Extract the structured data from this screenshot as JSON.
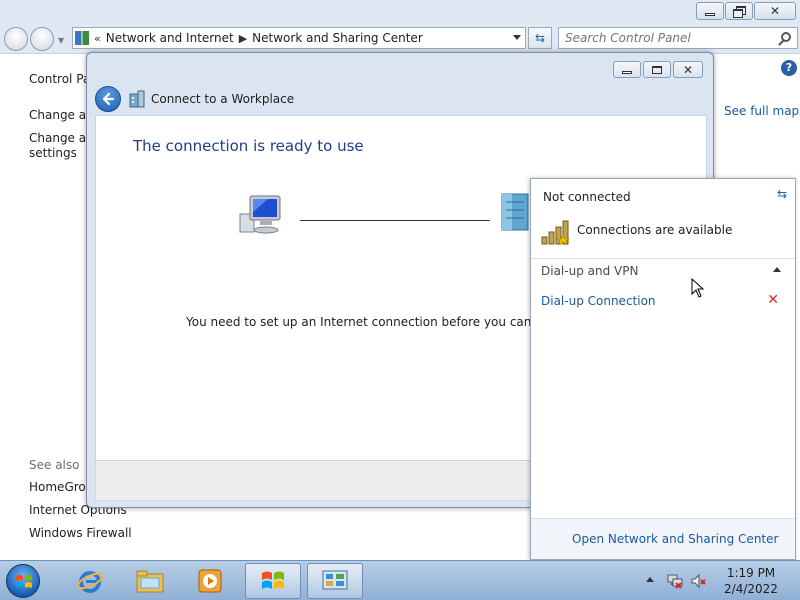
{
  "control_panel": {
    "breadcrumb_chevrons": "«",
    "breadcrumb": [
      "Network and Internet",
      "Network and Sharing Center"
    ],
    "search_placeholder": "Search Control Panel",
    "sidebar_links": [
      "Control Pa",
      "Change ad",
      "Change ad",
      "settings"
    ],
    "see_also_label": "See also",
    "see_also_links": [
      "HomeGrou",
      "Internet Options",
      "Windows Firewall"
    ],
    "see_full_map": "See full map",
    "help_glyph": "?"
  },
  "dialog": {
    "title": "Connect to a Workplace",
    "heading": "The connection is ready to use",
    "message": "You need to set up an Internet connection before you can connec"
  },
  "network_flyout": {
    "status": "Not connected",
    "availability": "Connections are available",
    "section_label": "Dial-up and VPN",
    "connections": [
      {
        "name": "Dial-up Connection",
        "status_icon": "red-x-icon"
      }
    ],
    "open_center_link": "Open Network and Sharing Center"
  },
  "taskbar": {
    "time": "1:19 PM",
    "date": "2/4/2022"
  },
  "colors": {
    "link_blue": "#1a5a9e",
    "heading_blue": "#1e3f8c",
    "error_red": "#d12a2a",
    "taskbar_top": "#b8cde6",
    "taskbar_bottom": "#8fb0d6"
  },
  "icons": [
    "back-arrow-icon",
    "control-panel-icon",
    "search-icon",
    "refresh-icon",
    "computer-icon",
    "server-icon",
    "signal-bars-icon",
    "red-x-icon",
    "help-icon",
    "start-orb-icon",
    "internet-explorer-icon",
    "explorer-folder-icon",
    "media-player-icon",
    "windows-flag-icon",
    "control-panel-taskbar-icon",
    "tray-network-icon",
    "tray-volume-icon"
  ]
}
